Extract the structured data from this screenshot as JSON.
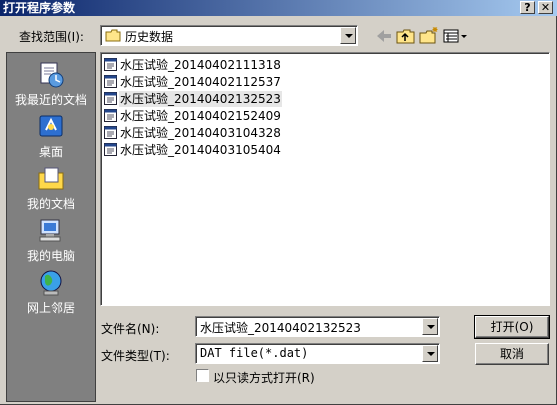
{
  "window": {
    "title": "打开程序参数",
    "help_label": "?",
    "close_label": "✕"
  },
  "toolbar": {
    "look_in_label": "查找范围(I):",
    "look_in_value": "历史数据",
    "icons": [
      "back-arrow-icon",
      "up-folder-icon",
      "new-folder-icon",
      "view-menu-icon"
    ]
  },
  "places": [
    {
      "label": "我最近的文档",
      "icon": "recent-documents-icon"
    },
    {
      "label": "桌面",
      "icon": "desktop-icon"
    },
    {
      "label": "我的文档",
      "icon": "my-documents-icon"
    },
    {
      "label": "我的电脑",
      "icon": "my-computer-icon"
    },
    {
      "label": "网上邻居",
      "icon": "network-icon"
    }
  ],
  "files": [
    {
      "name": "水压试验_20140402111318",
      "selected": false
    },
    {
      "name": "水压试验_20140402112537",
      "selected": false
    },
    {
      "name": "水压试验_20140402132523",
      "selected": true
    },
    {
      "name": "水压试验_20140402152409",
      "selected": false
    },
    {
      "name": "水压试验_20140403104328",
      "selected": false
    },
    {
      "name": "水压试验_20140403105404",
      "selected": false
    }
  ],
  "form": {
    "filename_label": "文件名(N):",
    "filename_value": "水压试验_20140402132523",
    "filetype_label": "文件类型(T):",
    "filetype_value": "DAT file(*.dat)",
    "readonly_label": "以只读方式打开(R)",
    "readonly_checked": false
  },
  "buttons": {
    "open_label": "打开(O)",
    "cancel_label": "取消"
  }
}
